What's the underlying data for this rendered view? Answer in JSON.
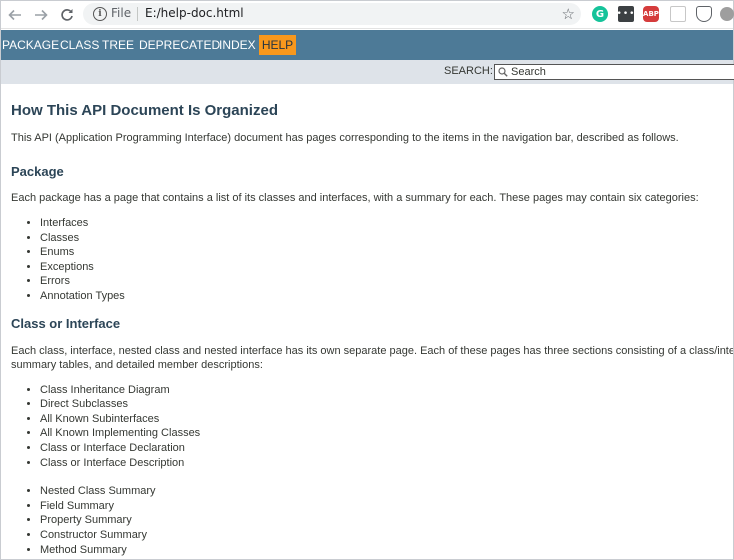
{
  "browser": {
    "scheme_label": "File",
    "url": "E:/help-doc.html",
    "star_glyph": "☆",
    "extensions": {
      "grammarly": "G",
      "dots": "•••",
      "abp": "ABP"
    }
  },
  "nav": {
    "items": [
      "PACKAGE",
      "CLASS",
      "TREE",
      "DEPRECATED",
      "INDEX"
    ],
    "active": "HELP"
  },
  "search": {
    "label": "SEARCH:",
    "placeholder": "Search"
  },
  "doc": {
    "title": "How This API Document Is Organized",
    "intro": "This API (Application Programming Interface) document has pages corresponding to the items in the navigation bar, described as follows.",
    "package": {
      "heading": "Package",
      "desc": "Each package has a page that contains a list of its classes and interfaces, with a summary for each. These pages may contain six categories:",
      "items": [
        "Interfaces",
        "Classes",
        "Enums",
        "Exceptions",
        "Errors",
        "Annotation Types"
      ]
    },
    "class_or_interface": {
      "heading": "Class or Interface",
      "desc_line1": "Each class, interface, nested class and nested interface has its own separate page. Each of these pages has three sections consisting of a class/interface d",
      "desc_line2": "summary tables, and detailed member descriptions:",
      "items_a": [
        "Class Inheritance Diagram",
        "Direct Subclasses",
        "All Known Subinterfaces",
        "All Known Implementing Classes",
        "Class or Interface Declaration",
        "Class or Interface Description"
      ],
      "items_b": [
        "Nested Class Summary",
        "Field Summary",
        "Property Summary",
        "Constructor Summary",
        "Method Summary"
      ]
    }
  }
}
